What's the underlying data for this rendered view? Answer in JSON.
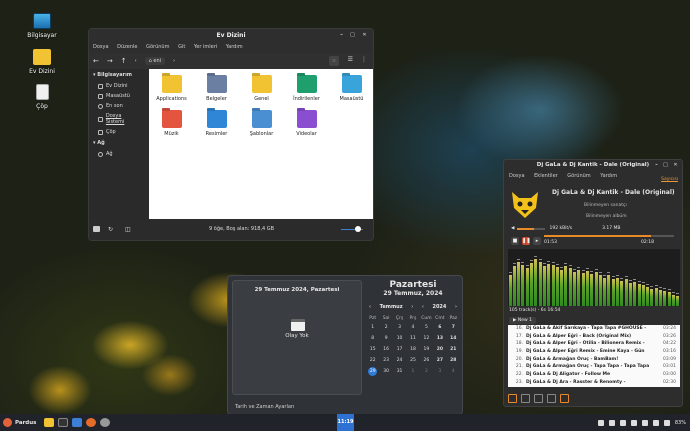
{
  "desktop": {
    "icons": [
      {
        "label": "Bilgisayar"
      },
      {
        "label": "Ev Dizini"
      },
      {
        "label": "Çöp"
      }
    ]
  },
  "file_manager": {
    "title": "Ev Dizini",
    "menu": [
      "Dosya",
      "Düzenle",
      "Görünüm",
      "Git",
      "Yer imleri",
      "Yardım"
    ],
    "path_label": "eni",
    "sidebar": {
      "section_computer": "Bilgisayarım",
      "computer_items": [
        "Ev Dizini",
        "Masaüstü",
        "En son",
        "Dosya Sistemi",
        "Çöp"
      ],
      "section_network": "Ağ",
      "network_items": [
        "Ağ"
      ]
    },
    "items": [
      {
        "name": "Applications",
        "color": "#f1c232"
      },
      {
        "name": "Belgeler",
        "color": "#6b7fa3"
      },
      {
        "name": "Genel",
        "color": "#f1c232"
      },
      {
        "name": "İndirilenler",
        "color": "#1f9e6e"
      },
      {
        "name": "Masaüstü",
        "color": "#3aa3d9"
      },
      {
        "name": "Müzik",
        "color": "#e3553f"
      },
      {
        "name": "Resimler",
        "color": "#2f86d6"
      },
      {
        "name": "Şablonlar",
        "color": "#4a8fd1"
      },
      {
        "name": "Videolar",
        "color": "#8a4fd1"
      }
    ],
    "status": "9 öğe, Boş alan: 918,4 GB",
    "zoom_level": 0.75
  },
  "calendar": {
    "selected_full": "29 Temmuz 2024, Pazartesi",
    "no_events": "Olay Yok",
    "settings_link": "Tarih ve Zaman Ayarları",
    "day_name": "Pazartesi",
    "big_date": "29 Temmuz, 2024",
    "month": "Temmuz",
    "year": "2024",
    "weekdays": [
      "Pzt",
      "Sal",
      "Çrş",
      "Prş",
      "Cum",
      "Cmt",
      "Paz"
    ],
    "weeks": [
      [
        "1",
        "2",
        "3",
        "4",
        "5",
        "6",
        "7"
      ],
      [
        "8",
        "9",
        "10",
        "11",
        "12",
        "13",
        "14"
      ],
      [
        "15",
        "16",
        "17",
        "18",
        "19",
        "20",
        "21"
      ],
      [
        "22",
        "23",
        "24",
        "25",
        "26",
        "27",
        "28"
      ],
      [
        "29",
        "30",
        "31",
        "1",
        "2",
        "3",
        "4"
      ]
    ],
    "today": "29"
  },
  "player": {
    "title": "Dj GaLa & Dj Kantik - Dale (Original)",
    "menu": [
      "Dosya",
      "Eklentiler",
      "Görünüm",
      "Yardım"
    ],
    "dir_link": "Sayıcısı",
    "song": "Dj GaLa & Dj Kantik - Dale (Original)",
    "artist": "Bilinmeyen sanatçı",
    "album": "Bilinmeyen albüm",
    "bitrate": "192 kBit/s",
    "size": "3.17 MB",
    "elapsed": "01:53",
    "total": "02:18",
    "progress": 0.82,
    "volume": 0.6,
    "playlist_summary": "105 track(s) - 6s 16:54",
    "playlist_tab": "New 1",
    "spectrum_levels": [
      0.55,
      0.7,
      0.78,
      0.72,
      0.66,
      0.75,
      0.82,
      0.78,
      0.7,
      0.74,
      0.72,
      0.68,
      0.64,
      0.7,
      0.66,
      0.6,
      0.64,
      0.58,
      0.62,
      0.56,
      0.6,
      0.55,
      0.5,
      0.54,
      0.48,
      0.5,
      0.44,
      0.48,
      0.4,
      0.42,
      0.38,
      0.36,
      0.34,
      0.3,
      0.32,
      0.28,
      0.26,
      0.24,
      0.2,
      0.18
    ],
    "tracks": [
      {
        "n": "16.",
        "title": "Dj GaLa & Akif Sarıkaya - Tapa Tapa #GHOUSE -",
        "dur": "03:24"
      },
      {
        "n": "17.",
        "title": "Dj GaLa & Alper Eğri - Back (Original Mix)",
        "dur": "03:26"
      },
      {
        "n": "18.",
        "title": "Dj GaLa & Alper Eğri - Otilia - Bilionera Remix -",
        "dur": "04:22"
      },
      {
        "n": "19.",
        "title": "Dj GaLa & Alper Eğri Remix - Emine Kaya - Gün",
        "dur": "03:16"
      },
      {
        "n": "20.",
        "title": "Dj GaLa & Armağan Oruç - BamBam!",
        "dur": "03:09"
      },
      {
        "n": "21.",
        "title": "Dj GaLa & Armağan Oruç - Tapa Tapa - Tapa Tapa",
        "dur": "03:01"
      },
      {
        "n": "22.",
        "title": "Dj GaLa & Dj Aligator - Follow Me",
        "dur": "03:00"
      },
      {
        "n": "23.",
        "title": "Dj GaLa & Dj Ara - Rasster & Renomty -",
        "dur": "02:30"
      }
    ]
  },
  "taskbar": {
    "start_label": "Pardus",
    "clock": "11:19",
    "battery": "83%"
  }
}
